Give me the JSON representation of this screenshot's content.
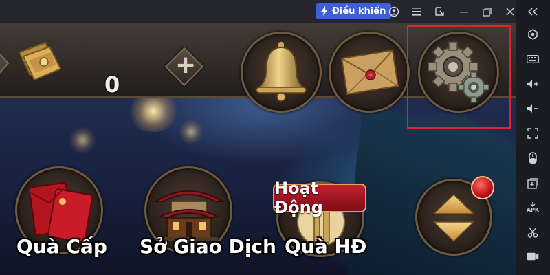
{
  "titlebar": {
    "control_label": "Điều khiển",
    "icons": [
      "lightning-icon",
      "account-icon",
      "menu-icon",
      "resize-icon",
      "minimize-icon",
      "restore-icon",
      "close-icon"
    ]
  },
  "sidebar": {
    "icons": [
      "collapse-icon",
      "hexagon-settings-icon",
      "keyboard-icon",
      "volume-up-icon",
      "volume-down-icon",
      "fullscreen-icon",
      "shake-icon",
      "add-window-icon",
      "apk-icon",
      "cut-icon",
      "record-icon"
    ],
    "apk_label": "APK"
  },
  "game": {
    "currency_count": "0",
    "event_badge": "Hoạt Động",
    "buttons": {
      "level_gift": "Quà Cấp",
      "trade_market": "Sở Giao Dịch",
      "activity_gift": "Quà HĐ"
    },
    "colors": {
      "highlight": "#e0232e",
      "accent": "#3f5fd6"
    }
  }
}
